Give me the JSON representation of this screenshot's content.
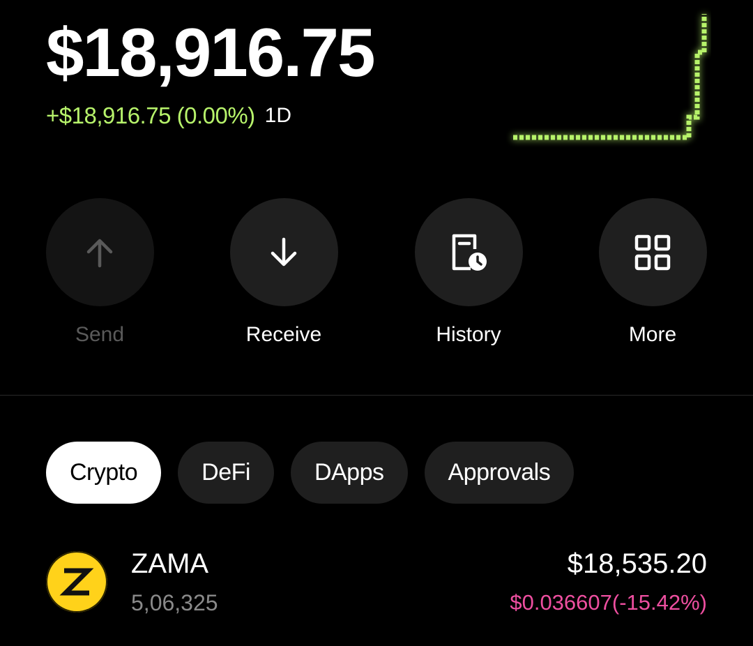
{
  "portfolio": {
    "balance": "$18,916.75",
    "change": "+$18,916.75 (0.00%)",
    "period": "1D",
    "accent_color": "#b7f36b"
  },
  "actions": [
    {
      "label": "Send",
      "icon": "arrow-up-icon",
      "enabled": false
    },
    {
      "label": "Receive",
      "icon": "arrow-down-icon",
      "enabled": true
    },
    {
      "label": "History",
      "icon": "history-icon",
      "enabled": true
    },
    {
      "label": "More",
      "icon": "grid-icon",
      "enabled": true
    }
  ],
  "tabs": [
    {
      "label": "Crypto",
      "active": true
    },
    {
      "label": "DeFi",
      "active": false
    },
    {
      "label": "DApps",
      "active": false
    },
    {
      "label": "Approvals",
      "active": false
    }
  ],
  "assets": [
    {
      "symbol": "ZAMA",
      "logo_letter": "Z",
      "logo_color": "#ffd21a",
      "amount": "5,06,325",
      "value": "$18,535.20",
      "price_change": "$0.036607(-15.42%)",
      "price_change_color": "#ee4fa0"
    }
  ]
}
